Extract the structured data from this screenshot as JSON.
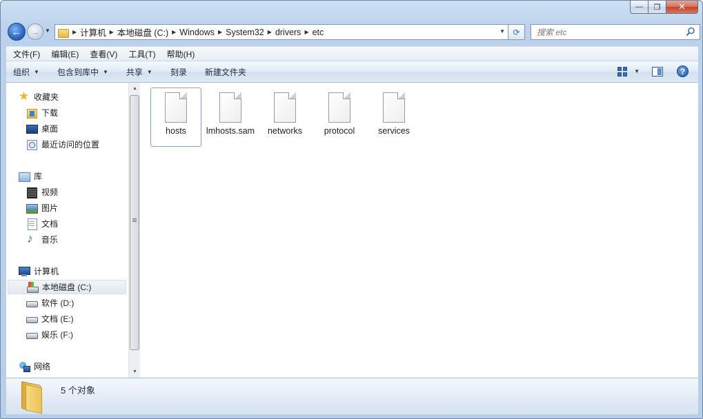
{
  "window": {
    "caption": {
      "minimize": "—",
      "maximize": "❐",
      "close": "✕"
    }
  },
  "nav": {
    "back": "←",
    "forward": "→",
    "breadcrumbs": [
      "计算机",
      "本地磁盘 (C:)",
      "Windows",
      "System32",
      "drivers",
      "etc"
    ],
    "search_placeholder": "搜索 etc",
    "refresh": "⟳"
  },
  "menu": [
    "文件(F)",
    "编辑(E)",
    "查看(V)",
    "工具(T)",
    "帮助(H)"
  ],
  "commands": {
    "organize": "组织",
    "include_in_library": "包含到库中",
    "share": "共享",
    "burn": "刻录",
    "new_folder": "新建文件夹",
    "help": "?"
  },
  "sidebar": {
    "favorites": {
      "label": "收藏夹",
      "items": [
        "下载",
        "桌面",
        "最近访问的位置"
      ]
    },
    "libraries": {
      "label": "库",
      "items": [
        "视频",
        "图片",
        "文档",
        "音乐"
      ]
    },
    "computer": {
      "label": "计算机",
      "items": [
        "本地磁盘 (C:)",
        "软件 (D:)",
        "文档 (E:)",
        "娱乐 (F:)"
      ]
    },
    "network": {
      "label": "网络"
    }
  },
  "files": [
    "hosts",
    "lmhosts.sam",
    "networks",
    "protocol",
    "services"
  ],
  "details": {
    "item_count": "5 个对象"
  },
  "colors": {
    "accent": "#2a68c2",
    "selection_border": "#7da2ce",
    "chrome": "#bcd2ec"
  }
}
